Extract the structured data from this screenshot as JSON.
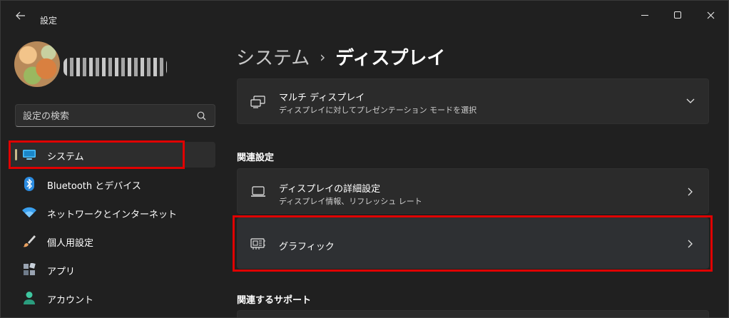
{
  "window": {
    "title": "設定",
    "back_icon": "arrow-left-icon",
    "controls": [
      "minimize-icon",
      "maximize-icon",
      "close-icon"
    ]
  },
  "profile": {
    "name_blurred": true
  },
  "search": {
    "placeholder": "設定の検索",
    "icon": "search-icon"
  },
  "sidebar": {
    "items": [
      {
        "label": "システム",
        "icon": "monitor-icon",
        "selected": true,
        "highlighted": true
      },
      {
        "label": "Bluetooth とデバイス",
        "icon": "bluetooth-icon"
      },
      {
        "label": "ネットワークとインターネット",
        "icon": "wifi-icon"
      },
      {
        "label": "個人用設定",
        "icon": "brush-icon"
      },
      {
        "label": "アプリ",
        "icon": "apps-icon"
      },
      {
        "label": "アカウント",
        "icon": "person-icon"
      }
    ]
  },
  "main": {
    "breadcrumb": {
      "parent": "システム",
      "separator": "›",
      "current": "ディスプレイ"
    },
    "multi_display": {
      "title": "マルチ ディスプレイ",
      "subtitle": "ディスプレイに対してプレゼンテーション モードを選択",
      "icon": "multi-monitor-icon",
      "chevron": "chevron-down-icon"
    },
    "related_heading": "関連設定",
    "related": [
      {
        "title": "ディスプレイの詳細設定",
        "subtitle": "ディスプレイ情報、リフレッシュ レート",
        "icon": "laptop-icon",
        "chevron": "chevron-right-icon"
      },
      {
        "title": "グラフィック",
        "icon": "graphics-card-icon",
        "chevron": "chevron-right-icon",
        "highlighted": true
      }
    ],
    "support_heading": "関連するサポート"
  },
  "colors": {
    "background": "#202020",
    "card": "#2b2b2b",
    "accent": "#c9bb8b",
    "highlight_box": "#e00000"
  }
}
